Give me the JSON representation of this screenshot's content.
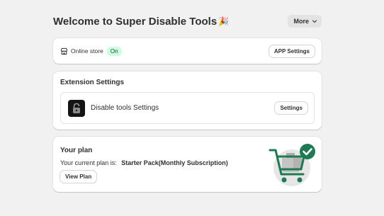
{
  "header": {
    "title": "Welcome to Super Disable Tools",
    "emoji": "🎉",
    "more_label": "More"
  },
  "store": {
    "label": "Online store",
    "status": "On",
    "app_settings_label": "APP Settings"
  },
  "extension": {
    "section_title": "Extension Settings",
    "item_name": "Disable tools Settings",
    "settings_label": "Settings"
  },
  "plan": {
    "section_title": "Your plan",
    "current_prefix": "Your current plan is:",
    "current_plan": "Starter Pack(Monthly Subscription)",
    "view_plan_label": "View Plan"
  },
  "colors": {
    "page_bg": "#f1f1f1",
    "badge_bg": "#cdfee1",
    "badge_text": "#0c5132",
    "accent_green": "#1f7a54"
  },
  "icons": [
    "chevron-down-icon",
    "store-icon",
    "lock-icon",
    "cart-illustration",
    "checkmark-icon"
  ]
}
